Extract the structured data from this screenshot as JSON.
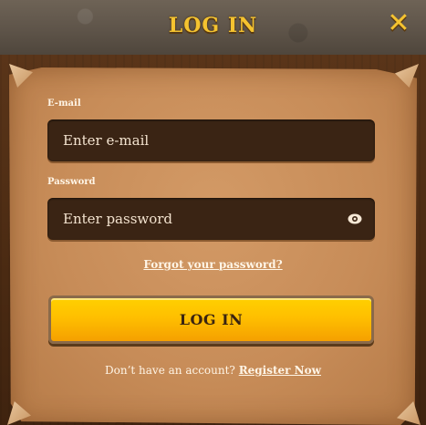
{
  "header": {
    "title": "LOG IN",
    "close_icon": "close-icon"
  },
  "form": {
    "email": {
      "label": "E-mail",
      "placeholder": "Enter e-mail",
      "value": ""
    },
    "password": {
      "label": "Password",
      "placeholder": "Enter password",
      "value": "",
      "visibility_icon": "eye-icon"
    },
    "forgot_link": "Forgot your password?",
    "login_button": "LOG IN",
    "register_prompt": "Don’t have an account?",
    "register_link": "Register Now"
  },
  "colors": {
    "accent": "#f5c330",
    "button": "#ffc300",
    "field_bg": "#3a2414",
    "parchment": "#c78c58"
  }
}
